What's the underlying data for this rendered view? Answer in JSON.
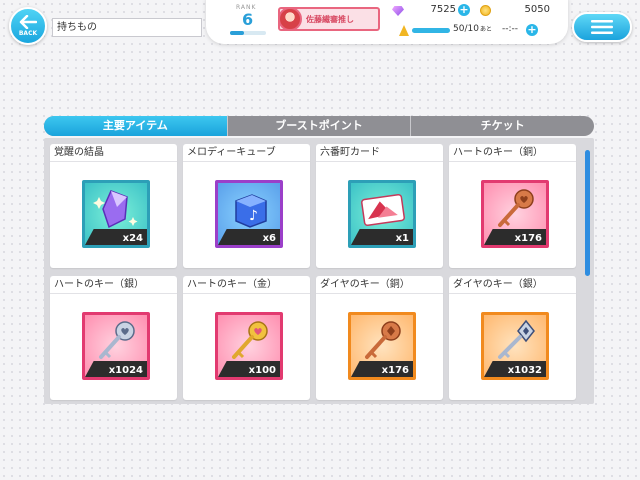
{
  "header": {
    "back_label": "BACK",
    "page_title": "持ちもの",
    "rank_label": "RANK",
    "rank_value": "6",
    "rank_progress": 0.4,
    "oshi_name": "佐藤繊審推し",
    "gems": "7525",
    "coins": "5050",
    "stamina": "50/10",
    "stamina_suffix": "あと",
    "stamina_timer": "--:--",
    "stamina_progress": 1.0
  },
  "tabs": [
    {
      "label": "主要アイテム",
      "active": true
    },
    {
      "label": "ブーストポイント",
      "active": false
    },
    {
      "label": "チケット",
      "active": false
    }
  ],
  "items": [
    {
      "name": "覚醒の結晶",
      "qty": "x24",
      "icon": "crystal-icon"
    },
    {
      "name": "メロディーキューブ",
      "qty": "x6",
      "icon": "melody-cube-icon"
    },
    {
      "name": "六番町カード",
      "qty": "x1",
      "icon": "card-icon"
    },
    {
      "name": "ハートのキー（銅）",
      "qty": "x176",
      "icon": "heart-key-bronze-icon"
    },
    {
      "name": "ハートのキー（銀）",
      "qty": "x1024",
      "icon": "heart-key-silver-icon"
    },
    {
      "name": "ハートのキー（金）",
      "qty": "x100",
      "icon": "heart-key-gold-icon"
    },
    {
      "name": "ダイヤのキー（銅）",
      "qty": "x176",
      "icon": "diamond-key-bronze-icon"
    },
    {
      "name": "ダイヤのキー（銀）",
      "qty": "x1032",
      "icon": "diamond-key-silver-icon"
    }
  ],
  "colors": {
    "accent": "#1aa6de",
    "tab_inactive": "#8f8f94",
    "oshi": "#e9667f"
  }
}
